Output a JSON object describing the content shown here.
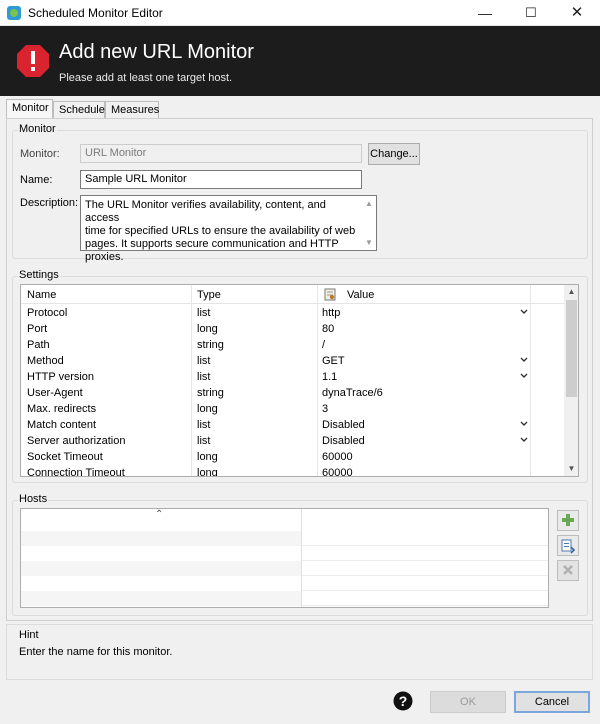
{
  "window": {
    "title": "Scheduled Monitor Editor"
  },
  "header": {
    "title": "Add new URL Monitor",
    "subtitle": "Please add at least one target host."
  },
  "tabs": [
    {
      "label": "Monitor"
    },
    {
      "label": "Schedule"
    },
    {
      "label": "Measures"
    }
  ],
  "monitor_group": {
    "label": "Monitor",
    "monitor_label": "Monitor:",
    "monitor_value": "URL Monitor",
    "change_button": "Change...",
    "name_label": "Name:",
    "name_value": "Sample URL Monitor",
    "description_label": "Description:",
    "description_lines": [
      "The URL Monitor verifies availability, content, and access",
      "time for specified URLs to ensure the availability of web",
      "pages. It supports secure communication and HTTP proxies."
    ]
  },
  "settings": {
    "label": "Settings",
    "columns": [
      "Name",
      "Type",
      "Value"
    ],
    "rows": [
      {
        "name": "Protocol",
        "type": "list",
        "value": "http",
        "dropdown": true
      },
      {
        "name": "Port",
        "type": "long",
        "value": "80",
        "dropdown": false
      },
      {
        "name": "Path",
        "type": "string",
        "value": "/",
        "dropdown": false
      },
      {
        "name": "Method",
        "type": "list",
        "value": "GET",
        "dropdown": true
      },
      {
        "name": "HTTP version",
        "type": "list",
        "value": "1.1",
        "dropdown": true
      },
      {
        "name": "User-Agent",
        "type": "string",
        "value": "dynaTrace/6",
        "dropdown": false
      },
      {
        "name": "Max. redirects",
        "type": "long",
        "value": "3",
        "dropdown": false
      },
      {
        "name": "Match content",
        "type": "list",
        "value": "Disabled",
        "dropdown": true
      },
      {
        "name": "Server authorization",
        "type": "list",
        "value": "Disabled",
        "dropdown": true
      },
      {
        "name": "Socket Timeout",
        "type": "long",
        "value": "60000",
        "dropdown": false
      },
      {
        "name": "Connection Timeout",
        "type": "long",
        "value": "60000",
        "dropdown": false
      }
    ]
  },
  "hosts": {
    "label": "Hosts"
  },
  "hint": {
    "title": "Hint",
    "text": "Enter the name for this monitor."
  },
  "footer": {
    "ok": "OK",
    "cancel": "Cancel"
  },
  "colors": {
    "header_bg": "#1c1c1c",
    "alert_red": "#d9232e",
    "add_green": "#6aa84f"
  }
}
